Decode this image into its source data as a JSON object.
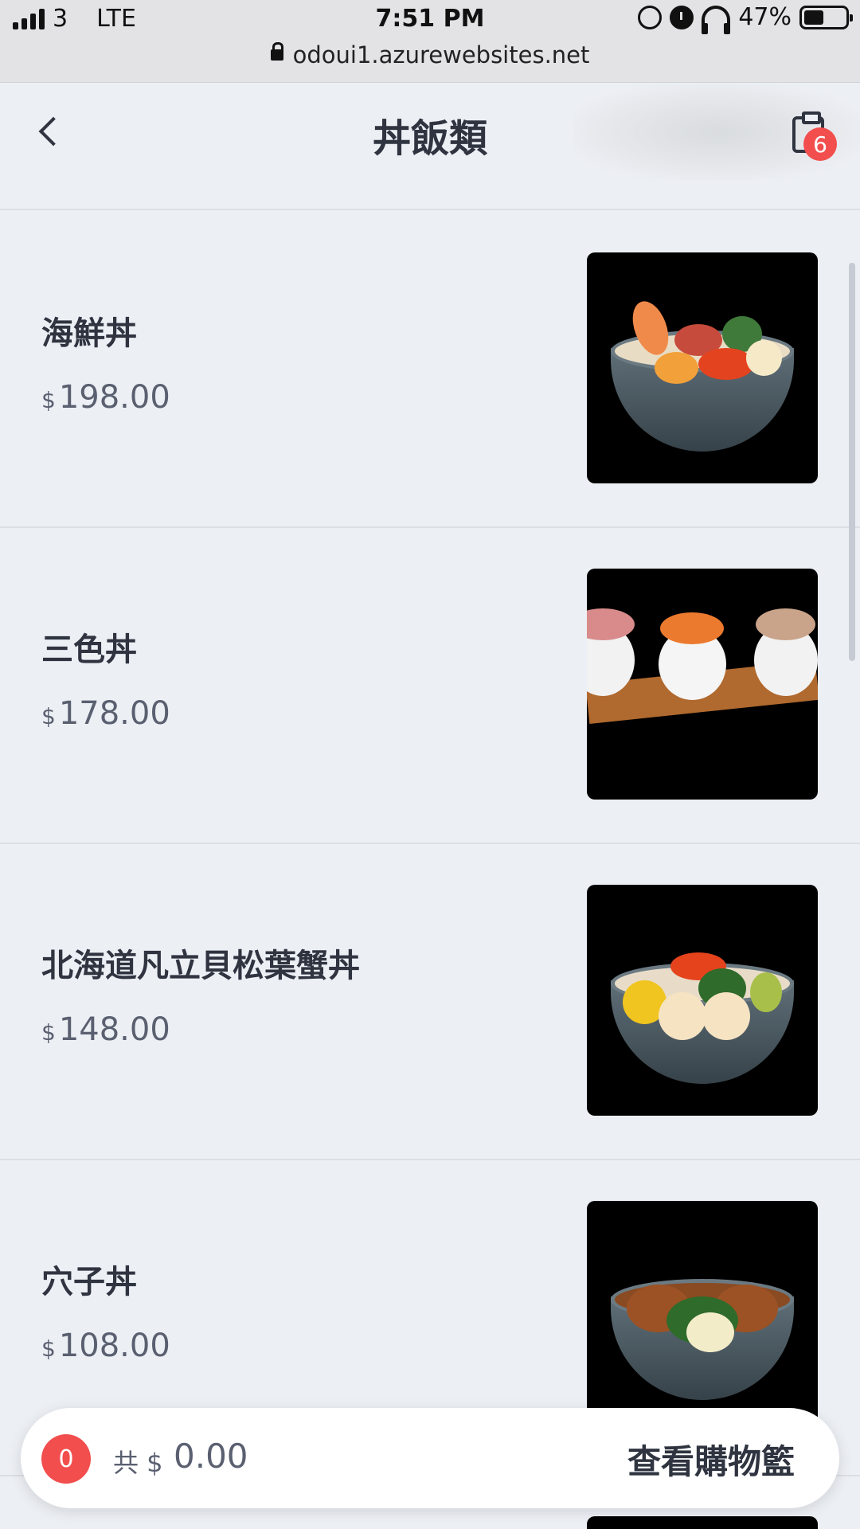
{
  "status_bar": {
    "carrier": "3",
    "network": "LTE",
    "time": "7:51 PM",
    "battery": "47%",
    "battery_level": 0.47,
    "url": "odoui1.azurewebsites.net"
  },
  "header": {
    "title": "丼飯類",
    "cart_badge": "6"
  },
  "items": [
    {
      "name": "海鮮丼",
      "currency": "$",
      "price": "198.00"
    },
    {
      "name": "三色丼",
      "currency": "$",
      "price": "178.00"
    },
    {
      "name": "北海道凡立貝松葉蟹丼",
      "currency": "$",
      "price": "148.00"
    },
    {
      "name": "穴子丼",
      "currency": "$",
      "price": "108.00"
    }
  ],
  "bottom_bar": {
    "count": "0",
    "total_label": "共 $",
    "total_value": "0.00",
    "view_cart_label": "查看購物籃"
  },
  "colors": {
    "background": "#eceff4",
    "accent_red": "#f24e4e",
    "text_primary": "#2f3440",
    "text_secondary": "#5a6070"
  }
}
